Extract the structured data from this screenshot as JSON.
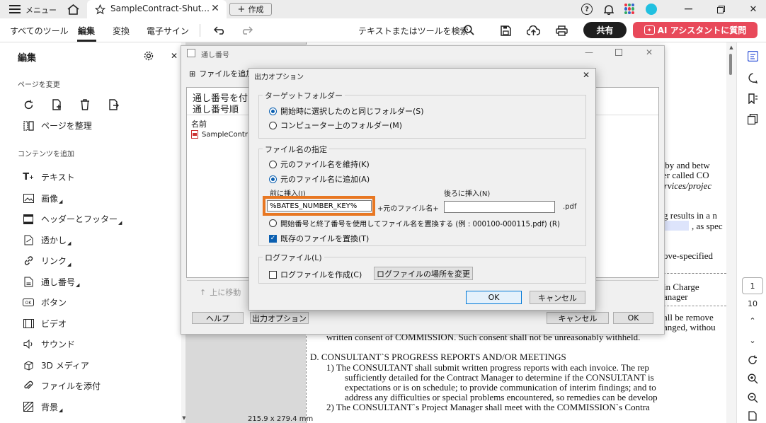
{
  "titlebar": {
    "menu_label": "メニュー",
    "tab_title": "SampleContract-Shut...",
    "create_label": "作成"
  },
  "toolbar": {
    "all_tools": "すべてのツール",
    "edit": "編集",
    "convert": "変換",
    "esign": "電子サイン",
    "search_label": "テキストまたはツールを検索",
    "share": "共有",
    "ai_assistant": "AI アシスタントに質問",
    "accent_color": "#e8495a"
  },
  "left_panel": {
    "title": "編集",
    "section_pages": "ページを変更",
    "organize_pages": "ページを整理",
    "section_content": "コンテンツを追加",
    "items": [
      {
        "label": "テキスト",
        "icon": "text-add-icon"
      },
      {
        "label": "画像",
        "icon": "image-icon"
      },
      {
        "label": "ヘッダーとフッター",
        "icon": "header-footer-icon"
      },
      {
        "label": "透かし",
        "icon": "watermark-icon"
      },
      {
        "label": "リンク",
        "icon": "link-icon"
      },
      {
        "label": "通し番号",
        "icon": "bates-number-icon"
      },
      {
        "label": "ボタン",
        "icon": "button-icon"
      },
      {
        "label": "ビデオ",
        "icon": "video-icon"
      },
      {
        "label": "サウンド",
        "icon": "sound-icon"
      },
      {
        "label": "3D メディア",
        "icon": "3d-media-icon"
      },
      {
        "label": "ファイルを添付",
        "icon": "attach-icon"
      },
      {
        "label": "背景",
        "icon": "background-icon"
      }
    ]
  },
  "document": {
    "lines": [
      "__ by and betw",
      "er called CO",
      "ervices/projec",
      "g results in a n",
      ", as spec",
      "ove-specified",
      "in Charge",
      "anager",
      "all be remove",
      "anged, withou",
      "written consent of COMMISSION.  Such consent shall not be unreasonably withheld.",
      "D.   CONSULTANT`S PROGRESS REPORTS AND/OR MEETINGS",
      "1)    The CONSULTANT shall submit written progress reports with each invoice.  The rep",
      "sufficiently detailed for the Contract Manager to determine if the CONSULTANT is",
      "expectations or is on schedule; to provide communication of interim findings; and to",
      "address any difficulties or special problems encountered, so remedies can be develop",
      "2)    The CONSULTANT`s Project Manager shall meet with the COMMISSION`s Contra"
    ],
    "page_size": "215.9 x 279.4 mm"
  },
  "right_bar": {
    "page_current": "1",
    "page_total": "10"
  },
  "bates_dialog": {
    "title": "通し番号",
    "add_files": "ファイルを追加",
    "header_line1": "通し番号を付",
    "header_line2": "通し番号順",
    "col_name": "名前",
    "file_name": "SampleContr",
    "move_up": "上に移動",
    "help": "ヘルプ",
    "output_options": "出力オプション",
    "cancel": "キャンセル",
    "ok": "OK"
  },
  "output_dialog": {
    "title": "出力オプション",
    "target_folder_group": "ターゲットフォルダー",
    "same_folder": "開始時に選択したのと同じフォルダー(S)",
    "computer_folder": "コンピューター上のフォルダー(M)",
    "filename_group": "ファイル名の指定",
    "keep_name": "元のファイル名を維持(K)",
    "add_to_name": "元のファイル名に追加(A)",
    "prefix_label": "前に挿入(I)",
    "prefix_value": "%BATES_NUMBER_KEY%",
    "plus_original": "+元のファイル名+",
    "suffix_label": "後ろに挿入(N)",
    "suffix_value": "",
    "pdf_ext": ".pdf",
    "replace_with_numbers": "開始番号と終了番号を使用してファイル名を置換する (例 : 000100-000115.pdf) (R)",
    "overwrite_existing": "既存のファイルを置換(T)",
    "log_group": "ログファイル(L)",
    "create_log": "ログファイルを作成(C)",
    "change_log_location": "ログファイルの場所を変更",
    "ok": "OK",
    "cancel": "キャンセル",
    "highlight_color": "#e87722"
  }
}
